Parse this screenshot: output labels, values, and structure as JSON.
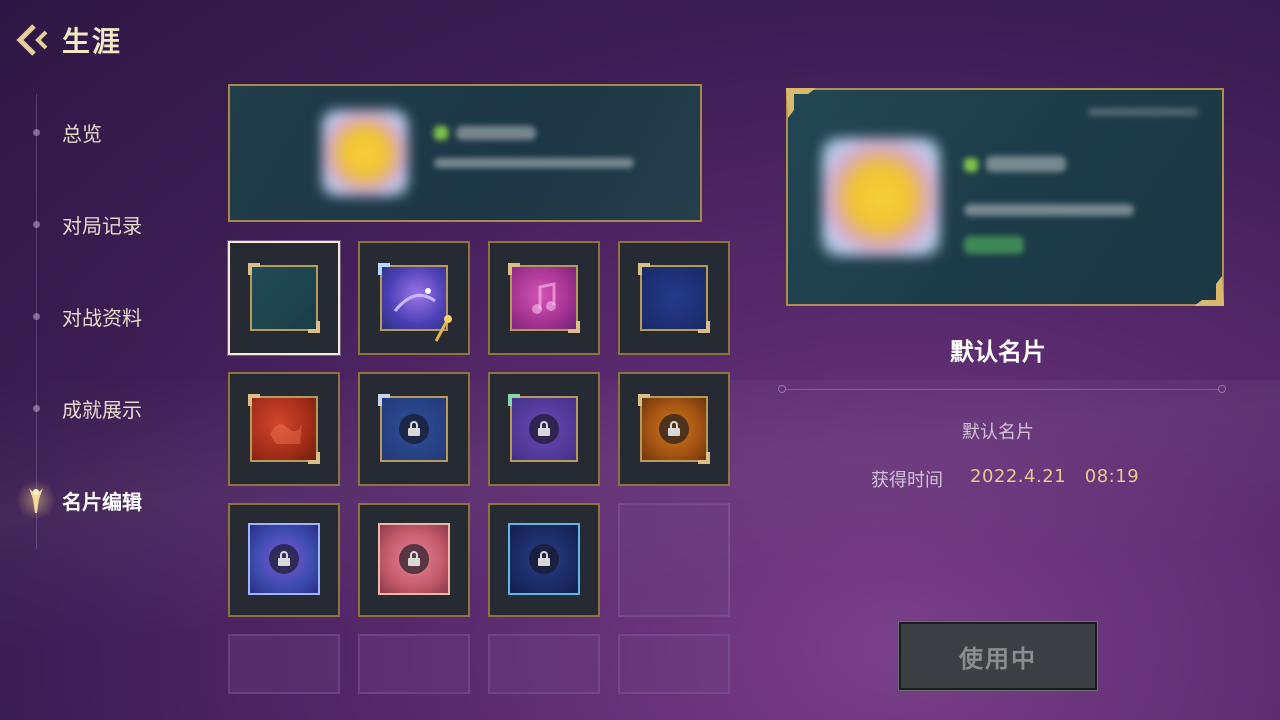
{
  "header": {
    "title": "生涯",
    "back_icon": "back-arrow-icon"
  },
  "sidebar": {
    "items": [
      {
        "label": "总览",
        "active": false
      },
      {
        "label": "对局记录",
        "active": false
      },
      {
        "label": "对战资料",
        "active": false
      },
      {
        "label": "成就展示",
        "active": false
      },
      {
        "label": "名片编辑",
        "active": true
      }
    ]
  },
  "grid": {
    "cards": [
      {
        "row": 0,
        "col": 0,
        "theme": "teal",
        "locked": false,
        "selected": true
      },
      {
        "row": 0,
        "col": 1,
        "theme": "cosmic",
        "locked": false,
        "selected": false
      },
      {
        "row": 0,
        "col": 2,
        "theme": "music",
        "locked": false,
        "selected": false
      },
      {
        "row": 0,
        "col": 3,
        "theme": "navy",
        "locked": false,
        "selected": false
      },
      {
        "row": 1,
        "col": 0,
        "theme": "red",
        "locked": false,
        "selected": false
      },
      {
        "row": 1,
        "col": 1,
        "theme": "blue",
        "locked": true,
        "selected": false
      },
      {
        "row": 1,
        "col": 2,
        "theme": "purple",
        "locked": true,
        "selected": false
      },
      {
        "row": 1,
        "col": 3,
        "theme": "orange",
        "locked": true,
        "selected": false
      },
      {
        "row": 2,
        "col": 0,
        "theme": "violet",
        "locked": true,
        "selected": false
      },
      {
        "row": 2,
        "col": 1,
        "theme": "peach",
        "locked": true,
        "selected": false
      },
      {
        "row": 2,
        "col": 2,
        "theme": "ocean",
        "locked": true,
        "selected": false
      },
      {
        "row": 2,
        "col": 3,
        "theme": "empty",
        "locked": false,
        "selected": false
      }
    ]
  },
  "detail": {
    "title": "默认名片",
    "card_name": "默认名片",
    "obtain_label": "获得时间",
    "obtain_time": "2022.4.21   08:19",
    "use_button": "使用中"
  },
  "colors": {
    "gold_border": "#8d7340",
    "accent_gold": "#e9c98b",
    "selected_border": "#f4ecd8"
  }
}
